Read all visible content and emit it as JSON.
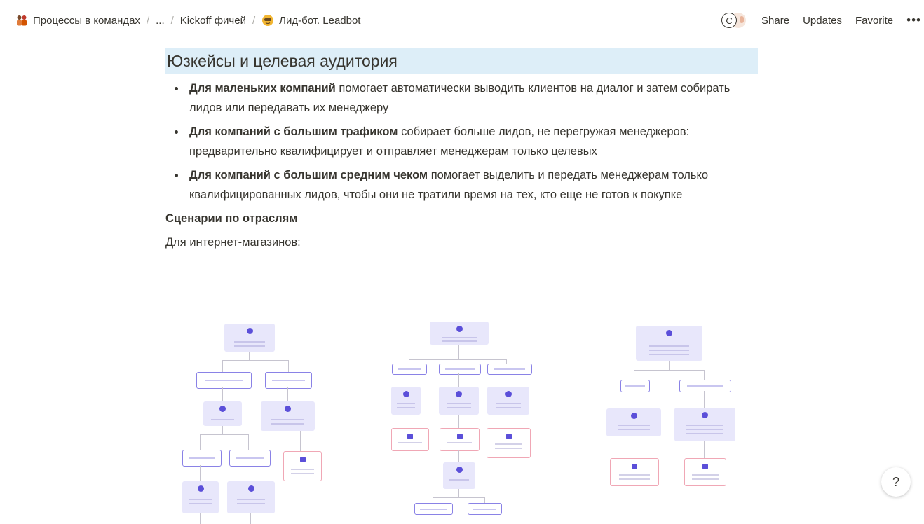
{
  "breadcrumb": {
    "items": [
      {
        "label": "Процессы в командах",
        "icon": "team-emoji-icon"
      },
      {
        "label": "..."
      },
      {
        "label": "Kickoff фичей"
      },
      {
        "label": "Лид-бот. Leadbot",
        "icon": "bot-face-emoji-icon"
      }
    ]
  },
  "header": {
    "avatar_letter": "C",
    "share_label": "Share",
    "updates_label": "Updates",
    "favorite_label": "Favorite",
    "more_label": "•••"
  },
  "main": {
    "heading": "Юзкейсы и целевая аудитория",
    "bullets": [
      {
        "bold": "Для маленьких компаний",
        "text": " помогает автоматически выводить клиентов на диалог и затем собирать лидов или передавать их менеджеру"
      },
      {
        "bold": "Для компаний с большим трафиком",
        "text": " собирает больше лидов, не перегружая менеджеров: предварительно квалифицирует и отправляет менеджерам только целевых"
      },
      {
        "bold": "Для компаний с большим средним чеком",
        "text": " помогает выделить и передать менеджерам только квалифицированных лидов, чтобы они не тратили время на тех, кто еще не готов к покупке"
      }
    ],
    "subheading": "Сценарии по отраслям",
    "paragraph": "Для интернет-магазинов:"
  },
  "help_label": "?",
  "colors": {
    "heading_bg": "#ddeef8",
    "node_bg": "#e8e7fb",
    "node_icon": "#5b4fd9",
    "option_border": "#8a82e6",
    "result_border": "#f0a7b5"
  }
}
